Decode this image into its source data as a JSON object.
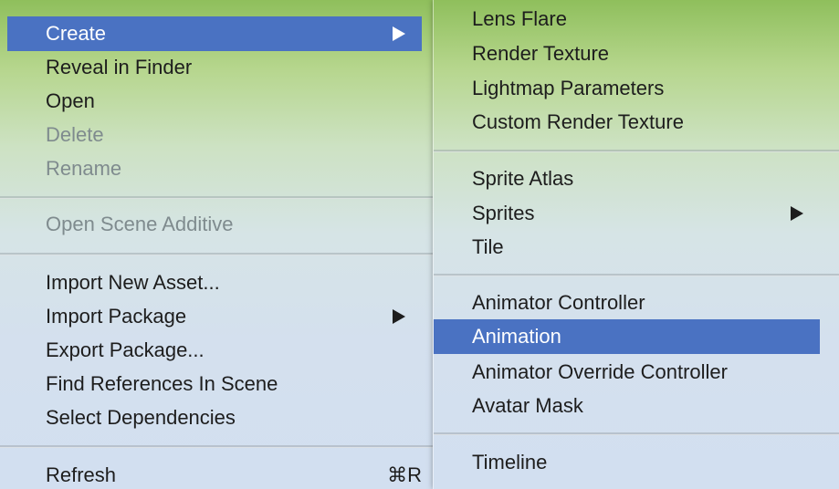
{
  "left_menu": {
    "create": "Create",
    "reveal_in_finder": "Reveal in Finder",
    "open": "Open",
    "delete": "Delete",
    "rename": "Rename",
    "open_scene_additive": "Open Scene Additive",
    "import_new_asset": "Import New Asset...",
    "import_package": "Import Package",
    "export_package": "Export Package...",
    "find_references": "Find References In Scene",
    "select_dependencies": "Select Dependencies",
    "refresh": "Refresh",
    "refresh_shortcut": "⌘R"
  },
  "submenu": {
    "lens_flare": "Lens Flare",
    "render_texture": "Render Texture",
    "lightmap_parameters": "Lightmap Parameters",
    "custom_render_texture": "Custom Render Texture",
    "sprite_atlas": "Sprite Atlas",
    "sprites": "Sprites",
    "tile": "Tile",
    "animator_controller": "Animator Controller",
    "animation": "Animation",
    "animator_override_controller": "Animator Override Controller",
    "avatar_mask": "Avatar Mask",
    "timeline": "Timeline"
  },
  "icons": {
    "submenu_arrow": "chevron-right-icon",
    "command_key": "command-icon"
  },
  "colors": {
    "highlight": "#4a72c2",
    "disabled_text": "#7f8b8e",
    "text": "#1d1d1d"
  }
}
